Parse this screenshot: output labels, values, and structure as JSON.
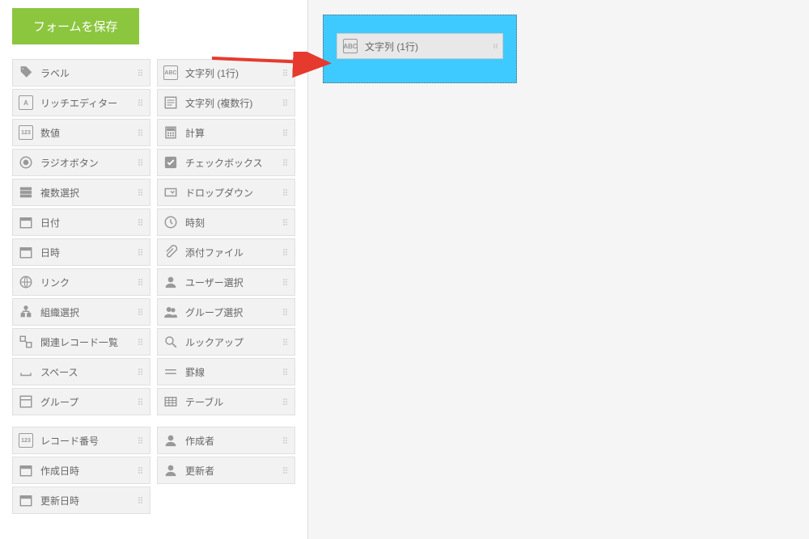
{
  "save_button_label": "フォームを保存",
  "palette_left": [
    {
      "icon": "tag",
      "label": "ラベル"
    },
    {
      "icon": "rich",
      "label": "リッチエディター"
    },
    {
      "icon": "number",
      "label": "数値"
    },
    {
      "icon": "radio",
      "label": "ラジオボタン"
    },
    {
      "icon": "multi",
      "label": "複数選択"
    },
    {
      "icon": "date",
      "label": "日付"
    },
    {
      "icon": "datetime",
      "label": "日時"
    },
    {
      "icon": "link",
      "label": "リンク"
    },
    {
      "icon": "org",
      "label": "組織選択"
    },
    {
      "icon": "related",
      "label": "関連レコード一覧"
    },
    {
      "icon": "space",
      "label": "スペース"
    },
    {
      "icon": "group",
      "label": "グループ"
    }
  ],
  "palette_right": [
    {
      "icon": "text",
      "label": "文字列 (1行)"
    },
    {
      "icon": "textarea",
      "label": "文字列 (複数行)"
    },
    {
      "icon": "calc",
      "label": "計算"
    },
    {
      "icon": "checkbox",
      "label": "チェックボックス"
    },
    {
      "icon": "dropdown",
      "label": "ドロップダウン"
    },
    {
      "icon": "time",
      "label": "時刻"
    },
    {
      "icon": "attach",
      "label": "添付ファイル"
    },
    {
      "icon": "user",
      "label": "ユーザー選択"
    },
    {
      "icon": "groupsel",
      "label": "グループ選択"
    },
    {
      "icon": "lookup",
      "label": "ルックアップ"
    },
    {
      "icon": "hr",
      "label": "罫線"
    },
    {
      "icon": "table",
      "label": "テーブル"
    }
  ],
  "palette_bottom_left": [
    {
      "icon": "recno",
      "label": "レコード番号"
    },
    {
      "icon": "createdt",
      "label": "作成日時"
    },
    {
      "icon": "updatedt",
      "label": "更新日時"
    }
  ],
  "palette_bottom_right": [
    {
      "icon": "creator",
      "label": "作成者"
    },
    {
      "icon": "updater",
      "label": "更新者"
    }
  ],
  "dropped_field": {
    "icon": "text",
    "label": "文字列 (1行)"
  }
}
